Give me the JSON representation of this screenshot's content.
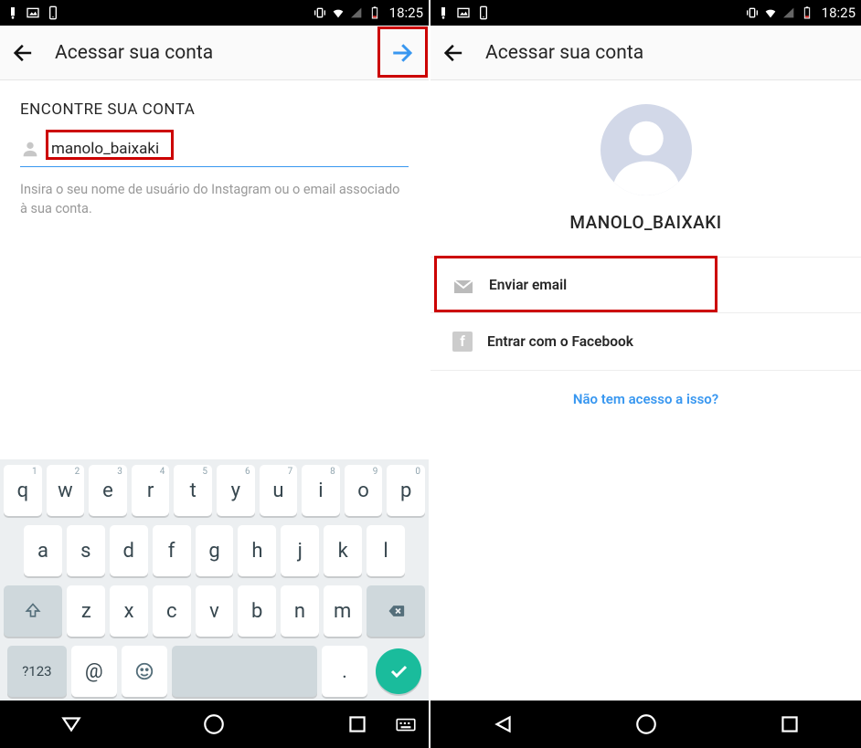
{
  "statusbar": {
    "time": "18:25"
  },
  "left": {
    "header": {
      "title": "Acessar sua conta"
    },
    "section_title": "ENCONTRE SUA CONTA",
    "input_value": "manolo_baixaki",
    "helper": "Insira o seu nome de usuário do Instagram ou o email associado à sua conta.",
    "keyboard": {
      "row1": [
        {
          "k": "q",
          "n": "1"
        },
        {
          "k": "w",
          "n": "2"
        },
        {
          "k": "e",
          "n": "3"
        },
        {
          "k": "r",
          "n": "4"
        },
        {
          "k": "t",
          "n": "5"
        },
        {
          "k": "y",
          "n": "6"
        },
        {
          "k": "u",
          "n": "7"
        },
        {
          "k": "i",
          "n": "8"
        },
        {
          "k": "o",
          "n": "9"
        },
        {
          "k": "p",
          "n": "0"
        }
      ],
      "row2": [
        "a",
        "s",
        "d",
        "f",
        "g",
        "h",
        "j",
        "k",
        "l"
      ],
      "row3": [
        "z",
        "x",
        "c",
        "v",
        "b",
        "n",
        "m"
      ],
      "sym": "?123",
      "at": "@",
      "dot": "."
    }
  },
  "right": {
    "header": {
      "title": "Acessar sua conta"
    },
    "username": "MANOLO_BAIXAKI",
    "option_email": "Enviar email",
    "option_facebook": "Entrar com o Facebook",
    "help_link": "Não tem acesso a isso?"
  }
}
